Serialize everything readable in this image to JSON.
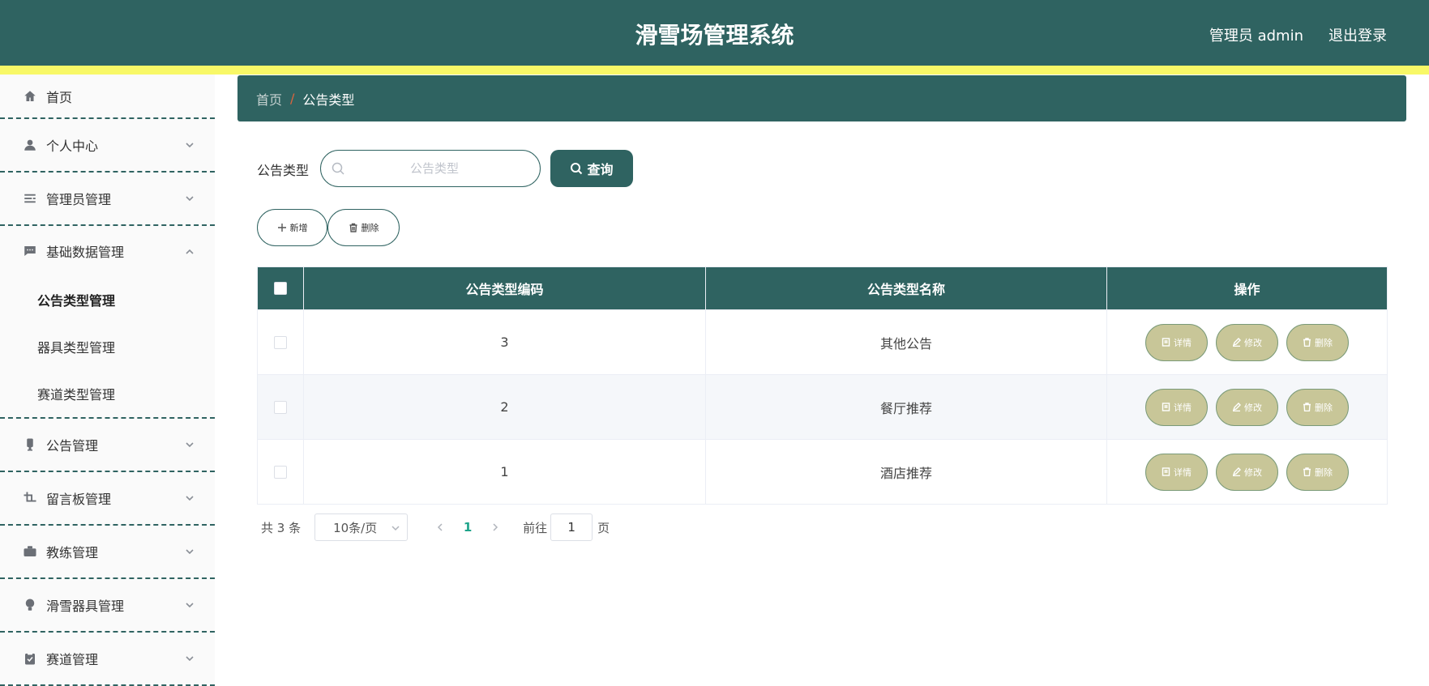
{
  "header": {
    "title": "滑雪场管理系统",
    "user": "管理员 admin",
    "logout": "退出登录"
  },
  "sidebar": {
    "items": [
      {
        "label": "首页",
        "icon": "home-icon"
      },
      {
        "label": "个人中心",
        "icon": "user-icon"
      },
      {
        "label": "管理员管理",
        "icon": "list-icon"
      },
      {
        "label": "基础数据管理",
        "icon": "chat-icon",
        "expanded": true,
        "children": [
          {
            "label": "公告类型管理",
            "active": true
          },
          {
            "label": "器具类型管理"
          },
          {
            "label": "赛道类型管理"
          }
        ]
      },
      {
        "label": "公告管理",
        "icon": "microphone-icon"
      },
      {
        "label": "留言板管理",
        "icon": "crop-icon"
      },
      {
        "label": "教练管理",
        "icon": "briefcase-icon"
      },
      {
        "label": "滑雪器具管理",
        "icon": "bulb-icon"
      },
      {
        "label": "赛道管理",
        "icon": "clipboard-icon"
      }
    ]
  },
  "breadcrumb": {
    "home": "首页",
    "separator": "/",
    "current": "公告类型"
  },
  "search": {
    "label": "公告类型",
    "placeholder": "公告类型",
    "value": "",
    "button": "查询"
  },
  "actions": {
    "add": "新增",
    "delete": "删除"
  },
  "table": {
    "columns": [
      "公告类型编码",
      "公告类型名称",
      "操作"
    ],
    "rows": [
      {
        "code": "3",
        "name": "其他公告"
      },
      {
        "code": "2",
        "name": "餐厅推荐"
      },
      {
        "code": "1",
        "name": "酒店推荐"
      }
    ],
    "row_actions": {
      "detail": "详情",
      "edit": "修改",
      "delete": "删除"
    }
  },
  "pagination": {
    "total": "共 3 条",
    "page_size": "10条/页",
    "current_page": "1",
    "goto_label": "前往",
    "goto_value": "1",
    "page_suffix": "页"
  },
  "colors": {
    "primary": "#2f6361",
    "accent_stripe": "#f8f867",
    "op_button": "#c8c698",
    "active_page": "#1ea48a"
  }
}
